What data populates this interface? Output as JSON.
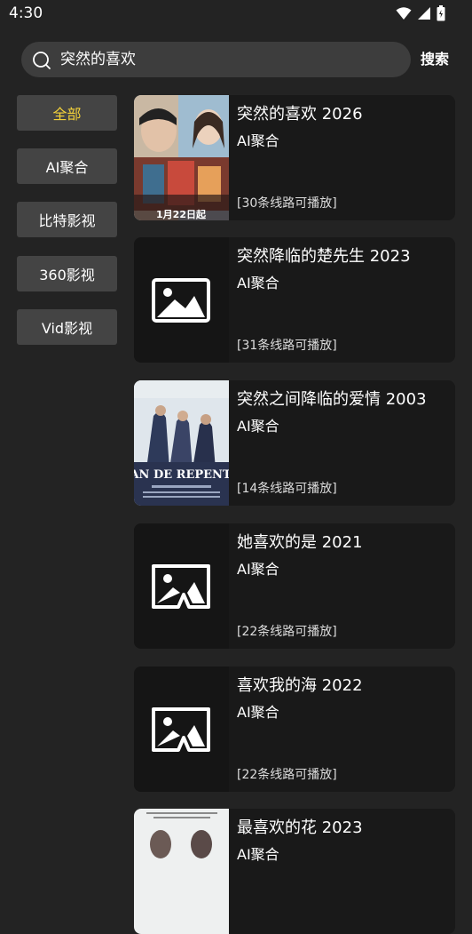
{
  "status": {
    "time": "4:30",
    "icons": [
      "wifi-icon",
      "signal-icon",
      "battery-icon"
    ]
  },
  "search": {
    "query": "突然的喜欢",
    "button_label": "搜索"
  },
  "categories": [
    {
      "label": "全部",
      "active": true
    },
    {
      "label": "AI聚合"
    },
    {
      "label": "比特影视"
    },
    {
      "label": "360影视"
    },
    {
      "label": "Vid影视"
    }
  ],
  "accent_color": "#f4d23a",
  "results": [
    {
      "title": "突然的喜欢 2026",
      "source": "AI聚合",
      "lines": "[30条线路可播放]",
      "poster": "photo",
      "poster_text": "1月22日起"
    },
    {
      "title": "突然降临的楚先生 2023",
      "source": "AI聚合",
      "lines": "[31条线路可播放]",
      "poster": "placeholder-image-icon"
    },
    {
      "title": "突然之间降临的爱情 2003",
      "source": "AI聚合",
      "lines": "[14条线路可播放]",
      "poster": "photo",
      "poster_text": "TAN DE REPENTE"
    },
    {
      "title": "她喜欢的是 2021",
      "source": "AI聚合",
      "lines": "[22条线路可播放]",
      "poster": "broken-image-icon"
    },
    {
      "title": "喜欢我的海 2022",
      "source": "AI聚合",
      "lines": "[22条线路可播放]",
      "poster": "broken-image-icon"
    },
    {
      "title": "最喜欢的花 2023",
      "source": "AI聚合",
      "lines": "",
      "poster": "photo"
    }
  ]
}
